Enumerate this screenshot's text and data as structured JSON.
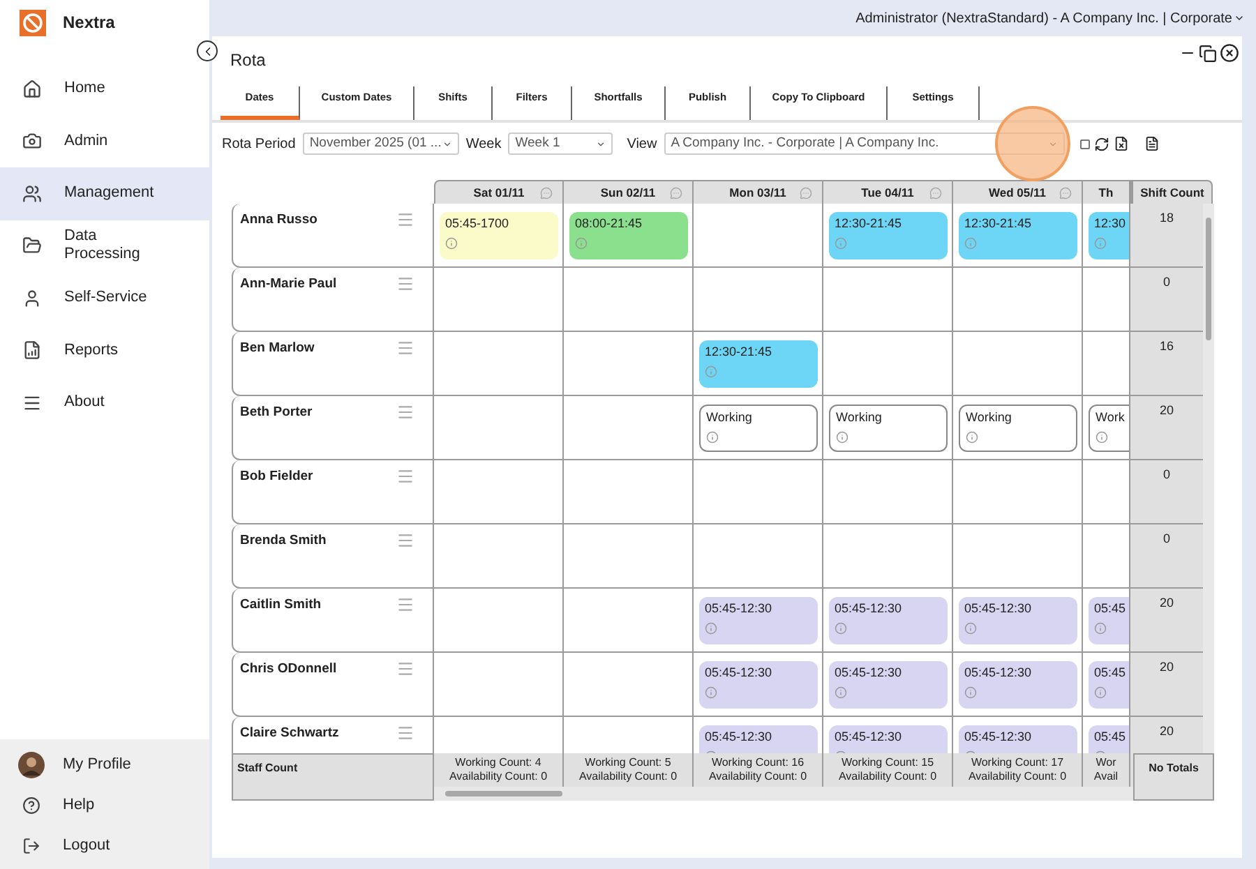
{
  "app": {
    "name": "Nextra"
  },
  "sidebar": {
    "items": [
      {
        "label": "Home",
        "selected": false
      },
      {
        "label": "Admin",
        "selected": false
      },
      {
        "label": "Management",
        "selected": true
      },
      {
        "label": "Data Processing",
        "selected": false
      },
      {
        "label": "Self-Service",
        "selected": false
      },
      {
        "label": "Reports",
        "selected": false
      },
      {
        "label": "About",
        "selected": false
      }
    ],
    "footer_items": [
      {
        "label": "My Profile"
      },
      {
        "label": "Help"
      },
      {
        "label": "Logout"
      }
    ]
  },
  "top_bar": {
    "user": "Administrator (NextraStandard) - A Company Inc. | Corporate"
  },
  "panel": {
    "title": "Rota"
  },
  "tabs": [
    {
      "label": "Dates",
      "selected": true
    },
    {
      "label": "Custom Dates",
      "selected": false
    },
    {
      "label": "Shifts",
      "selected": false
    },
    {
      "label": "Filters",
      "selected": false
    },
    {
      "label": "Shortfalls",
      "selected": false
    },
    {
      "label": "Publish",
      "selected": false
    },
    {
      "label": "Copy To Clipboard",
      "selected": false
    },
    {
      "label": "Settings",
      "selected": false
    }
  ],
  "filters": {
    "rota_period_label": "Rota Period",
    "rota_period": "November 2025 (01 ...",
    "week_label": "Week",
    "week": "Week 1",
    "view_label": "View",
    "view": "A Company Inc. - Corporate | A Company Inc.",
    "checkbox_checked": false
  },
  "grid": {
    "columns": [
      "Sat 01/11",
      "Sun 02/11",
      "Mon 03/11",
      "Tue 04/11",
      "Wed 05/11",
      "Th"
    ],
    "shift_count_label": "Shift Count",
    "rows": [
      {
        "name": "Anna Russo",
        "shift_count": "18",
        "cells": [
          {
            "kind": "shift",
            "text": "05:45-1700",
            "color": "#fbfac9"
          },
          {
            "kind": "shift",
            "text": "08:00-21:45",
            "color": "#8ae08c"
          },
          {
            "kind": "empty"
          },
          {
            "kind": "shift",
            "text": "12:30-21:45",
            "color": "#6dd6f6"
          },
          {
            "kind": "shift",
            "text": "12:30-21:45",
            "color": "#6dd6f6"
          },
          {
            "kind": "shift",
            "text": "12:30",
            "color": "#6dd6f6"
          }
        ]
      },
      {
        "name": "Ann-Marie Paul",
        "shift_count": "0",
        "cells": [
          {
            "kind": "empty"
          },
          {
            "kind": "empty"
          },
          {
            "kind": "empty"
          },
          {
            "kind": "empty"
          },
          {
            "kind": "empty"
          },
          {
            "kind": "empty"
          }
        ]
      },
      {
        "name": "Ben Marlow",
        "shift_count": "16",
        "cells": [
          {
            "kind": "empty"
          },
          {
            "kind": "empty"
          },
          {
            "kind": "shift",
            "text": "12:30-21:45",
            "color": "#6dd6f6"
          },
          {
            "kind": "empty"
          },
          {
            "kind": "empty"
          },
          {
            "kind": "empty"
          }
        ]
      },
      {
        "name": "Beth Porter",
        "shift_count": "20",
        "cells": [
          {
            "kind": "empty"
          },
          {
            "kind": "empty"
          },
          {
            "kind": "availability",
            "text": "Working"
          },
          {
            "kind": "availability",
            "text": "Working"
          },
          {
            "kind": "availability",
            "text": "Working"
          },
          {
            "kind": "availability",
            "text": "Work"
          }
        ]
      },
      {
        "name": "Bob Fielder",
        "shift_count": "0",
        "cells": [
          {
            "kind": "empty"
          },
          {
            "kind": "empty"
          },
          {
            "kind": "empty"
          },
          {
            "kind": "empty"
          },
          {
            "kind": "empty"
          },
          {
            "kind": "empty"
          }
        ]
      },
      {
        "name": "Brenda Smith",
        "shift_count": "0",
        "cells": [
          {
            "kind": "empty"
          },
          {
            "kind": "empty"
          },
          {
            "kind": "empty"
          },
          {
            "kind": "empty"
          },
          {
            "kind": "empty"
          },
          {
            "kind": "empty"
          }
        ]
      },
      {
        "name": "Caitlin Smith",
        "shift_count": "20",
        "cells": [
          {
            "kind": "empty"
          },
          {
            "kind": "empty"
          },
          {
            "kind": "shift",
            "text": "05:45-12:30",
            "color": "#d7d5f1"
          },
          {
            "kind": "shift",
            "text": "05:45-12:30",
            "color": "#d7d5f1"
          },
          {
            "kind": "shift",
            "text": "05:45-12:30",
            "color": "#d7d5f1"
          },
          {
            "kind": "shift",
            "text": "05:45",
            "color": "#d7d5f1"
          }
        ]
      },
      {
        "name": "Chris ODonnell",
        "shift_count": "20",
        "cells": [
          {
            "kind": "empty"
          },
          {
            "kind": "empty"
          },
          {
            "kind": "shift",
            "text": "05:45-12:30",
            "color": "#d7d5f1"
          },
          {
            "kind": "shift",
            "text": "05:45-12:30",
            "color": "#d7d5f1"
          },
          {
            "kind": "shift",
            "text": "05:45-12:30",
            "color": "#d7d5f1"
          },
          {
            "kind": "shift",
            "text": "05:45",
            "color": "#d7d5f1"
          }
        ]
      },
      {
        "name": "Claire Schwartz",
        "shift_count": "20",
        "cells": [
          {
            "kind": "empty"
          },
          {
            "kind": "empty"
          },
          {
            "kind": "shift",
            "text": "05:45-12:30",
            "color": "#d7d5f1"
          },
          {
            "kind": "shift",
            "text": "05:45-12:30",
            "color": "#d7d5f1"
          },
          {
            "kind": "shift",
            "text": "05:45-12:30",
            "color": "#d7d5f1"
          },
          {
            "kind": "shift",
            "text": "05:45",
            "color": "#d7d5f1"
          }
        ]
      }
    ],
    "footer": {
      "label": "Staff Count",
      "totals": "No Totals",
      "counts": [
        {
          "working": "Working Count: 4",
          "availability": "Availability Count: 0"
        },
        {
          "working": "Working Count: 5",
          "availability": "Availability Count: 0"
        },
        {
          "working": "Working Count: 16",
          "availability": "Availability Count: 0"
        },
        {
          "working": "Working Count: 15",
          "availability": "Availability Count: 0"
        },
        {
          "working": "Working Count: 17",
          "availability": "Availability Count: 0"
        },
        {
          "working": "Wor",
          "availability": "Avail"
        }
      ]
    }
  }
}
